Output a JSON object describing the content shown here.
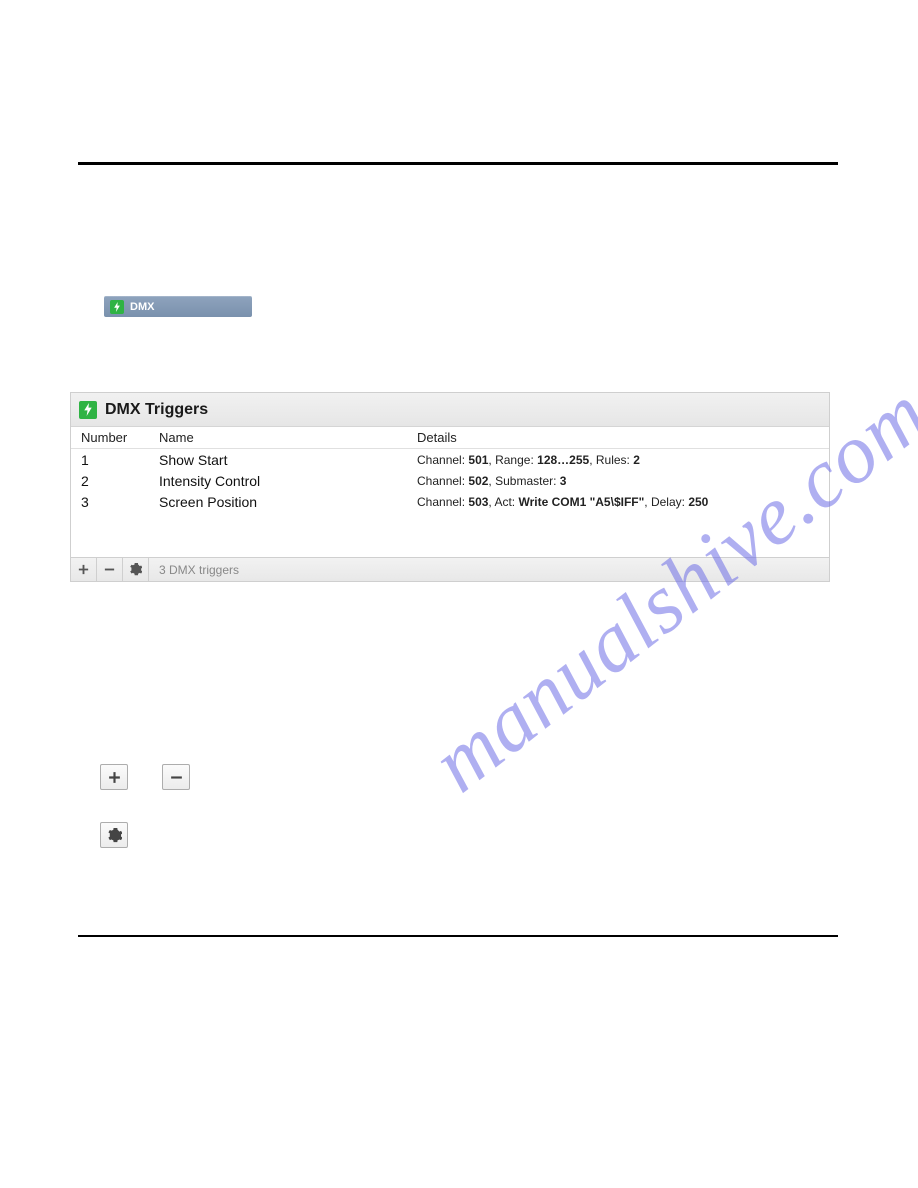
{
  "tab": {
    "label": "DMX"
  },
  "panel": {
    "title": "DMX Triggers",
    "columns": {
      "number": "Number",
      "name": "Name",
      "details": "Details"
    },
    "footer_text": "3 DMX triggers",
    "rows": [
      {
        "number": "1",
        "name": "Show Start",
        "details": {
          "channel_label": "Channel:",
          "channel": "501",
          "range_label": "Range:",
          "range": "128…255",
          "rules_label": "Rules:",
          "rules": "2"
        }
      },
      {
        "number": "2",
        "name": "Intensity Control",
        "details": {
          "channel_label": "Channel:",
          "channel": "502",
          "submaster_label": "Submaster:",
          "submaster": "3"
        }
      },
      {
        "number": "3",
        "name": "Screen Position",
        "details": {
          "channel_label": "Channel:",
          "channel": "503",
          "act_label": "Act:",
          "act": "Write COM1 \"A5\\$IFF\"",
          "delay_label": "Delay:",
          "delay": "250"
        }
      }
    ]
  },
  "watermark": "manualshive.com"
}
